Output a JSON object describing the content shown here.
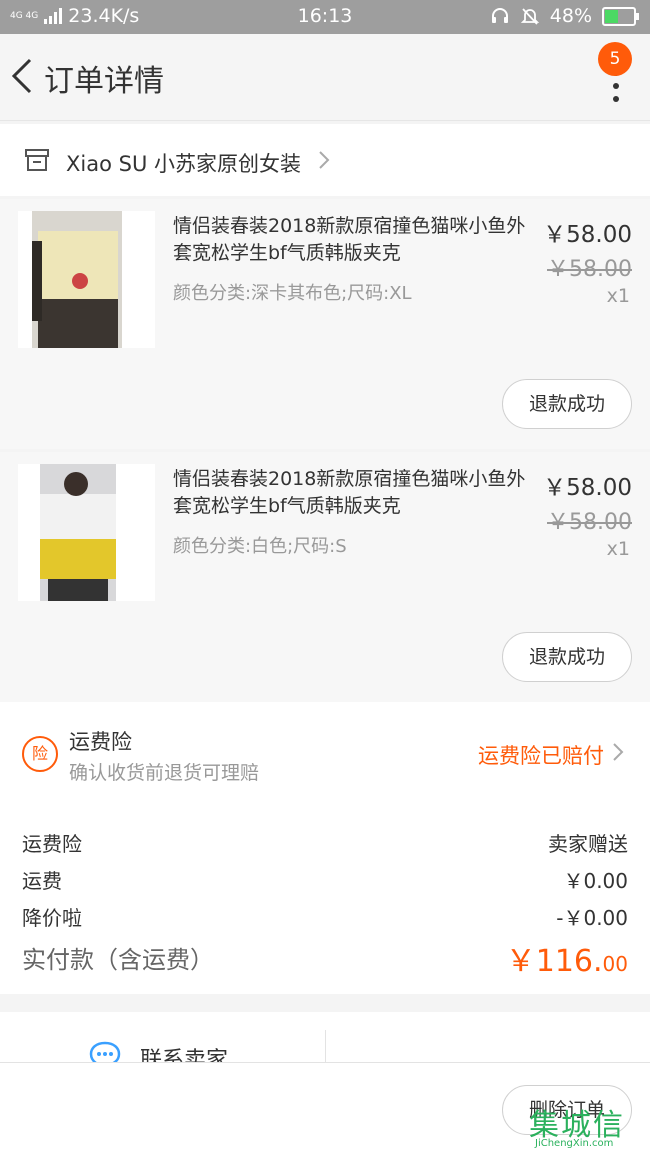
{
  "status_bar": {
    "network": "4G 4G",
    "speed": "23.4K/s",
    "time": "16:13",
    "battery": "48%",
    "battery_level": 0.48
  },
  "header": {
    "title": "订单详情",
    "badge_count": "5"
  },
  "shop": {
    "name": "Xiao SU 小苏家原创女装"
  },
  "items": [
    {
      "title": "情侣装春装2018新款原宿撞色猫咪小鱼外套宽松学生bf气质韩版夹克",
      "spec": "颜色分类:深卡其布色;尺码:XL",
      "price": "￥58.00",
      "original_price": "￥58.00",
      "quantity": "x1",
      "status": "退款成功"
    },
    {
      "title": "情侣装春装2018新款原宿撞色猫咪小鱼外套宽松学生bf气质韩版夹克",
      "spec": "颜色分类:白色;尺码:S",
      "price": "￥58.00",
      "original_price": "￥58.00",
      "quantity": "x1",
      "status": "退款成功"
    }
  ],
  "insurance": {
    "icon_text": "险",
    "title": "运费险",
    "subtitle": "确认收货前退货可理赔",
    "status": "运费险已赔付"
  },
  "fees": [
    {
      "label": "运费险",
      "value": "卖家赠送"
    },
    {
      "label": "运费",
      "value": "￥0.00"
    },
    {
      "label": "降价啦",
      "value": "-￥0.00"
    }
  ],
  "total": {
    "label": "实付款（含运费）",
    "value_main": "￥116.",
    "value_cents": "00"
  },
  "contact": {
    "label": "联系卖家"
  },
  "bottom": {
    "delete_label": "删除订单"
  },
  "watermark": {
    "logo": "集城信",
    "url": "JiChengXin.com"
  },
  "colors": {
    "accent": "#ff5b0a",
    "status_bar": "#9e9e9e"
  }
}
